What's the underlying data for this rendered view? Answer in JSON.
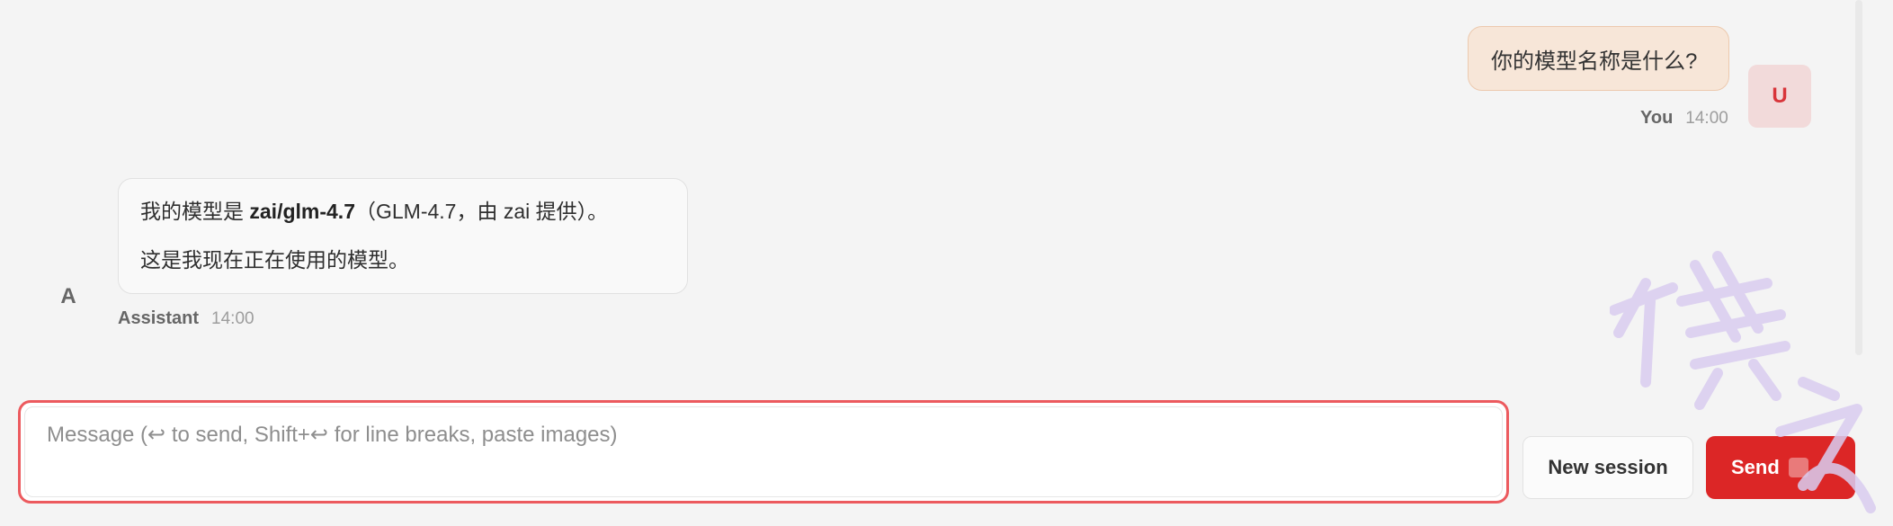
{
  "conversation": {
    "user_message": {
      "text": "你的模型名称是什么?",
      "avatar_letter": "U",
      "sender": "You",
      "time": "14:00"
    },
    "assistant_message": {
      "line1_before": "我的模型是 ",
      "line1_bold": "zai/glm-4.7",
      "line1_after": "（GLM-4.7，由 zai 提供）。",
      "line2": "这是我现在正在使用的模型。",
      "avatar_letter": "A",
      "sender": "Assistant",
      "time": "14:00"
    }
  },
  "composer": {
    "placeholder": "Message (↩ to send, Shift+↩ for line breaks, paste images)",
    "value": ""
  },
  "actions": {
    "new_session_label": "New session",
    "send_label": "Send"
  },
  "watermark": {
    "text": "棋之"
  },
  "colors": {
    "accent": "#dc2626",
    "user_bubble": "#f7e6d8",
    "background": "#f4f4f4"
  }
}
